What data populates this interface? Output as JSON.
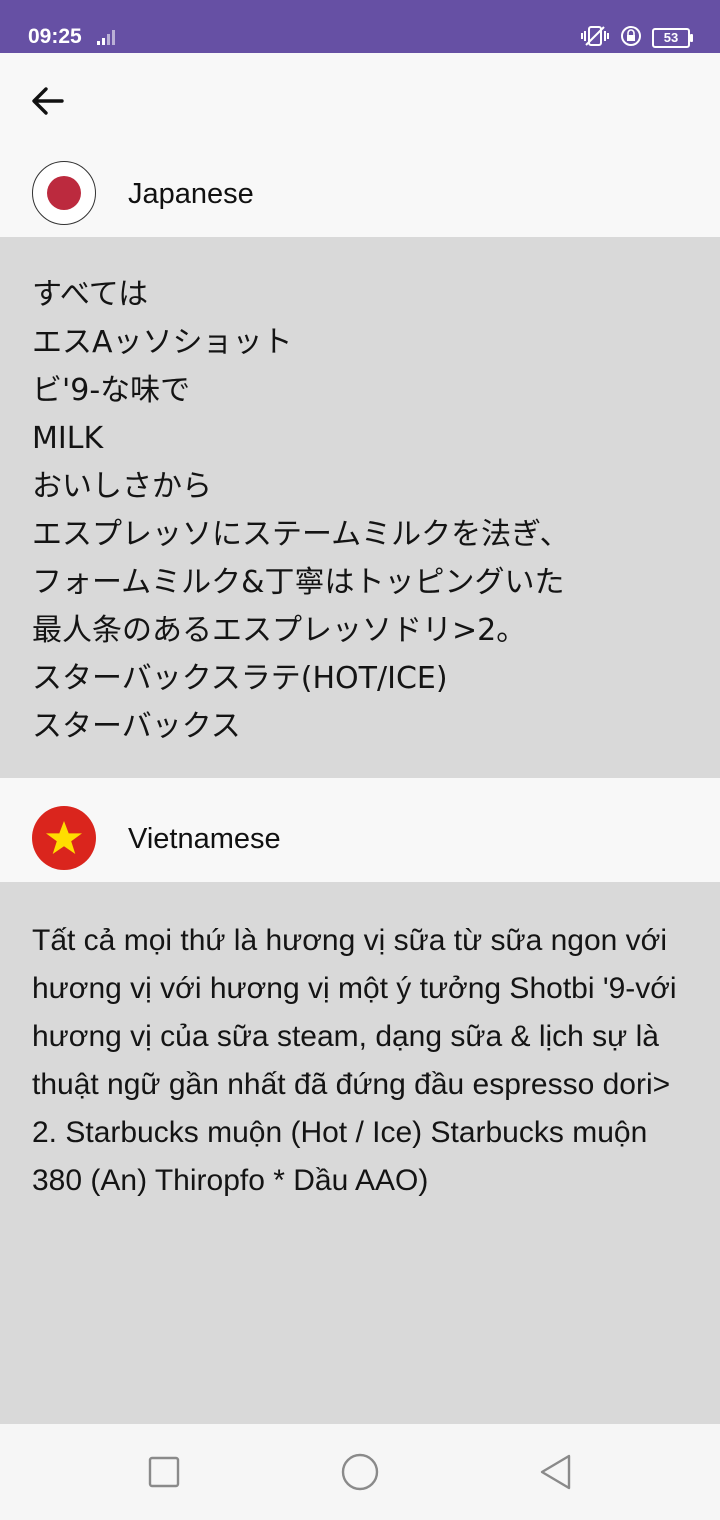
{
  "status_bar": {
    "time": "09:25",
    "battery": "53",
    "bg_color": "#6650a4"
  },
  "top_bar": {
    "back_icon": "arrow-left-icon"
  },
  "sections": [
    {
      "language": "Japanese",
      "flag_icon": "japan-flag-icon",
      "lines": [
        "すべては",
        "エスAッソショット",
        "ビ'9-な味で",
        "MILK",
        "おいしさから",
        "エスプレッソにステームミルクを法ぎ、",
        "フォームミルク&丁寧はトッピングいた",
        "最人条のあるエスプレッソドリ>2。",
        "スターバックスラテ(HOT/ICE)",
        "スターバックス"
      ]
    },
    {
      "language": "Vietnamese",
      "flag_icon": "vietnam-flag-icon",
      "text": "Tất cả mọi thứ là hương vị sữa từ sữa ngon với hương vị với hương vị một ý tưởng Shotbi '9-với hương vị của sữa steam, dạng sữa & lịch sự là thuật ngữ gần nhất đã đứng đầu espresso dori> 2. Starbucks muộn (Hot / Ice) Starbucks muộn 380 (An) Thiropfo * Dầu AAO)"
    }
  ],
  "colors": {
    "panel_bg": "#d9d9d9",
    "page_bg": "#f8f8f8",
    "japan_red": "#bc2a3e",
    "vietnam_red": "#da251d",
    "vietnam_star": "#ffdd00"
  },
  "nav_bar": {
    "icons": [
      "recent-apps-icon",
      "home-icon",
      "back-triangle-icon"
    ]
  }
}
